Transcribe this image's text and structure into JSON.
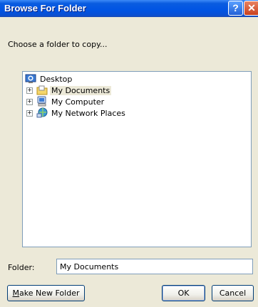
{
  "window": {
    "title": "Browse For Folder",
    "help_icon": "?",
    "close_icon": "✕"
  },
  "prompt": "Choose a folder to copy...",
  "tree": {
    "root": {
      "label": "Desktop",
      "icon": "desktop-icon"
    },
    "items": [
      {
        "label": "My Documents",
        "icon": "my-documents-folder-icon",
        "expander": "+",
        "selected": true
      },
      {
        "label": "My Computer",
        "icon": "my-computer-icon",
        "expander": "+",
        "selected": false
      },
      {
        "label": "My Network Places",
        "icon": "network-places-icon",
        "expander": "+",
        "selected": false
      }
    ]
  },
  "folder_field": {
    "label": "Folder:",
    "value": "My Documents"
  },
  "buttons": {
    "make_new_folder_m": "M",
    "make_new_folder_rest": "ake New Folder",
    "ok": "OK",
    "cancel": "Cancel"
  },
  "colors": {
    "title_bar": "#0054e3",
    "dialog_bg": "#ece9d8",
    "border": "#7f9db9"
  }
}
